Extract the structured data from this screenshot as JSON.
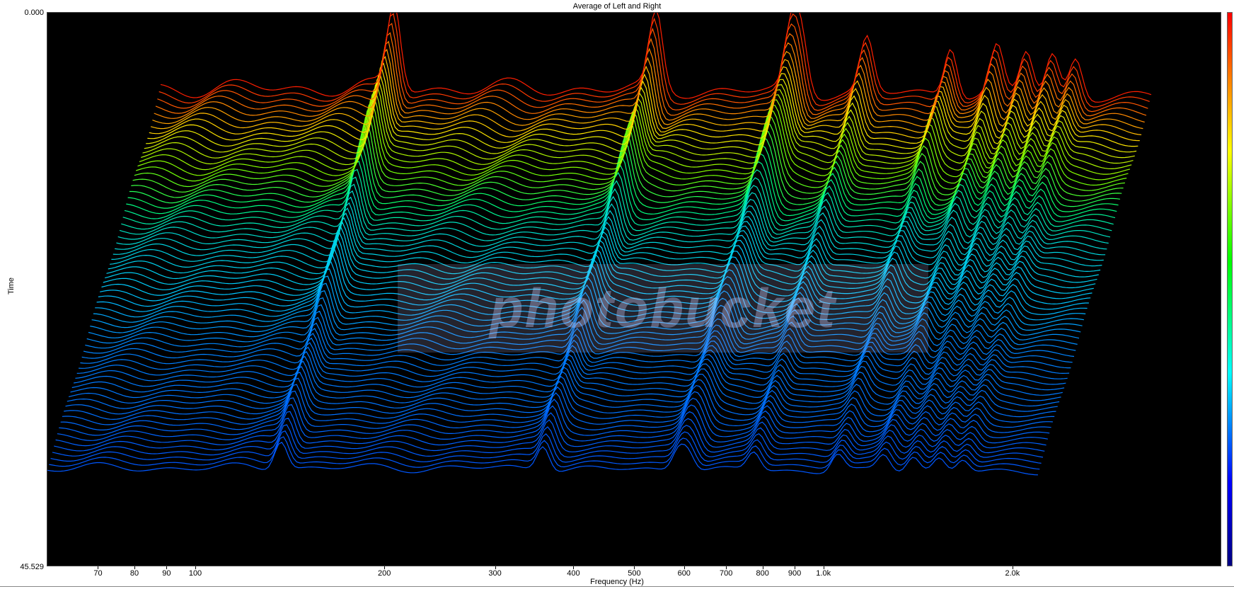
{
  "chart_data": {
    "type": "waterfall",
    "title": "Average of Left and Right",
    "xlabel": "Frequency (Hz)",
    "ylabel": "Time",
    "x_scale": "log",
    "xlim": [
      58,
      4300
    ],
    "time_range": [
      0.0,
      45.529
    ],
    "y_tick_labels": [
      "0.000",
      "45.529"
    ],
    "x_tick_labels": [
      {
        "value": 70,
        "label": "70"
      },
      {
        "value": 80,
        "label": "80"
      },
      {
        "value": 90,
        "label": "90"
      },
      {
        "value": 100,
        "label": "100"
      },
      {
        "value": 200,
        "label": "200"
      },
      {
        "value": 300,
        "label": "300"
      },
      {
        "value": 400,
        "label": "400"
      },
      {
        "value": 500,
        "label": "500"
      },
      {
        "value": 600,
        "label": "600"
      },
      {
        "value": 700,
        "label": "700"
      },
      {
        "value": 800,
        "label": "800"
      },
      {
        "value": 900,
        "label": "900"
      },
      {
        "value": 1000,
        "label": "1.0k"
      },
      {
        "value": 2000,
        "label": "2.0k"
      }
    ],
    "color_scale": [
      "#ff0000",
      "#ff8000",
      "#ffff00",
      "#00ff00",
      "#00ffff",
      "#0000ff",
      "#000080"
    ],
    "peaks_hz": [
      160,
      500,
      900,
      940,
      1250,
      1800,
      2200,
      2500,
      2800,
      3100
    ],
    "peak_levels": [
      1.0,
      0.95,
      0.85,
      0.78,
      0.8,
      0.82,
      0.78,
      0.76,
      0.72,
      0.7
    ]
  },
  "watermark": {
    "text": "photobucket"
  }
}
